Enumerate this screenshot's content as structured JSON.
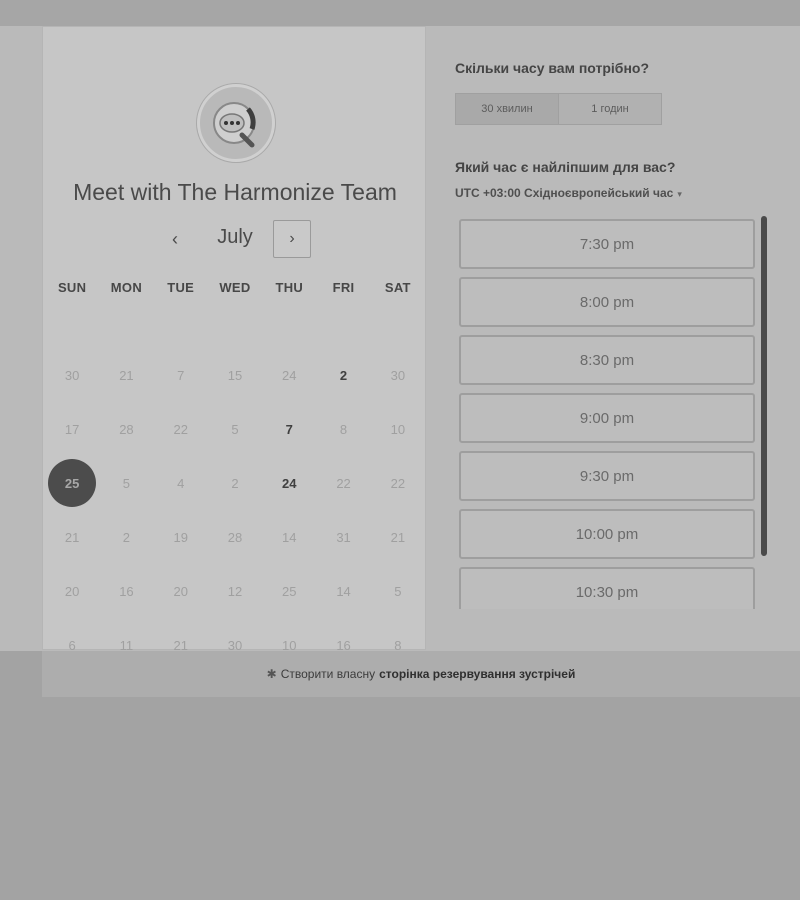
{
  "card": {
    "title": "Meet with The Harmonize Team",
    "month": "July",
    "prev_icon": "‹",
    "next_icon": "›",
    "weekdays": [
      "SUN",
      "MON",
      "TUE",
      "WED",
      "THU",
      "FRI",
      "SAT"
    ],
    "weeks": [
      [
        {
          "d": "30",
          "s": "off"
        },
        {
          "d": "21",
          "s": "off"
        },
        {
          "d": "7",
          "s": "off"
        },
        {
          "d": "15",
          "s": "off"
        },
        {
          "d": "24",
          "s": "off"
        },
        {
          "d": "2",
          "s": "avail"
        },
        {
          "d": "30",
          "s": "off"
        }
      ],
      [
        {
          "d": "17",
          "s": "off"
        },
        {
          "d": "28",
          "s": "off"
        },
        {
          "d": "22",
          "s": "off"
        },
        {
          "d": "5",
          "s": "off"
        },
        {
          "d": "7",
          "s": "avail"
        },
        {
          "d": "8",
          "s": "off"
        },
        {
          "d": "10",
          "s": "off"
        }
      ],
      [
        {
          "d": "25",
          "s": "selected"
        },
        {
          "d": "5",
          "s": "off"
        },
        {
          "d": "4",
          "s": "off"
        },
        {
          "d": "2",
          "s": "off"
        },
        {
          "d": "24",
          "s": "avail"
        },
        {
          "d": "22",
          "s": "off"
        },
        {
          "d": "22",
          "s": "off"
        }
      ],
      [
        {
          "d": "21",
          "s": "off"
        },
        {
          "d": "2",
          "s": "off"
        },
        {
          "d": "19",
          "s": "off"
        },
        {
          "d": "28",
          "s": "off"
        },
        {
          "d": "14",
          "s": "off"
        },
        {
          "d": "31",
          "s": "off"
        },
        {
          "d": "21",
          "s": "off"
        }
      ],
      [
        {
          "d": "20",
          "s": "off"
        },
        {
          "d": "16",
          "s": "off"
        },
        {
          "d": "20",
          "s": "off"
        },
        {
          "d": "12",
          "s": "off"
        },
        {
          "d": "25",
          "s": "off"
        },
        {
          "d": "14",
          "s": "off"
        },
        {
          "d": "5",
          "s": "off"
        }
      ],
      [
        {
          "d": "6",
          "s": "off"
        },
        {
          "d": "11",
          "s": "off"
        },
        {
          "d": "21",
          "s": "off"
        },
        {
          "d": "30",
          "s": "off"
        },
        {
          "d": "10",
          "s": "off"
        },
        {
          "d": "16",
          "s": "off"
        },
        {
          "d": "8",
          "s": "off"
        }
      ]
    ]
  },
  "right": {
    "duration_question": "Скільки часу вам потрібно?",
    "durations": [
      "30 хвилин",
      "1 годин"
    ],
    "time_question": "Який час є найліпшим для вас?",
    "timezone": "UTC +03:00 Східноєвропейський час",
    "slots": [
      "7:30 pm",
      "8:00 pm",
      "8:30 pm",
      "9:00 pm",
      "9:30 pm",
      "10:00 pm",
      "10:30 pm"
    ]
  },
  "footer": {
    "text": "Створити власну",
    "link": "сторінка резервування зустрічей"
  },
  "colors": {
    "background": "#a3a3a3",
    "card": "#c6c6c6",
    "selected_day": "#4c4c4c"
  }
}
